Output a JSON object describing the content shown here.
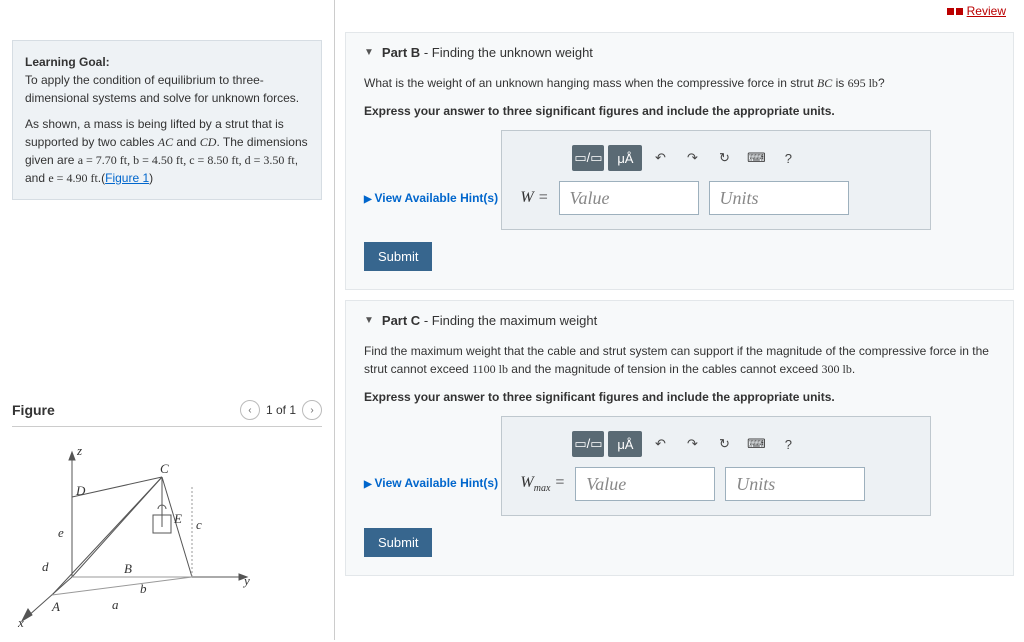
{
  "topbar": {
    "review_label": "Review"
  },
  "learning_goal": {
    "heading": "Learning Goal:",
    "line1": "To apply the condition of equilibrium to three-dimensional systems and solve for unknown forces.",
    "line2_pre": "As shown, a mass is being lifted by a strut that is supported by two cables ",
    "ac": "AC",
    "and_text": " and ",
    "cd": "CD",
    "line2_mid": ". The dimensions given are ",
    "dims": "a = 7.70 ft, b = 4.50 ft, c = 8.50 ft, d = 3.50 ft",
    "and2": ", and ",
    "e_dim": "e = 4.90 ft",
    "dot": ".(",
    "figure_link": "Figure 1",
    "close": ")"
  },
  "figure_panel": {
    "title": "Figure",
    "pager_center": "1 of 1"
  },
  "partB": {
    "part_label": "Part B",
    "dash_title": " - Finding the unknown weight",
    "q_pre": "What is the weight of an unknown hanging mass when the compressive force in strut ",
    "bc": "BC",
    "q_mid": " is ",
    "force_val": "695 lb",
    "qmark": "?",
    "instruction": "Express your answer to three significant figures and include the appropriate units.",
    "hints_label": "View Available Hint(s)",
    "var": "W =",
    "value_ph": "Value",
    "units_ph": "Units",
    "submit_label": "Submit"
  },
  "partC": {
    "part_label": "Part C",
    "dash_title": " - Finding the maximum weight",
    "q_pre": "Find the maximum weight that the cable and strut system can support if the magnitude of the compressive force in the strut cannot exceed ",
    "lim1": "1100 lb",
    "q_mid": " and the magnitude of tension in the cables cannot exceed ",
    "lim2": "300 lb",
    "dot": ".",
    "instruction": "Express your answer to three significant figures and include the appropriate units.",
    "hints_label": "View Available Hint(s)",
    "var": "Wₘₐₓ =",
    "value_ph": "Value",
    "units_ph": "Units",
    "submit_label": "Submit"
  },
  "toolbar_icons": {
    "fraction": "▭/▭",
    "units_btn": "μÅ",
    "undo": "↶",
    "redo": "↷",
    "reset": "↻",
    "keyboard": "⌨",
    "help": "?"
  }
}
